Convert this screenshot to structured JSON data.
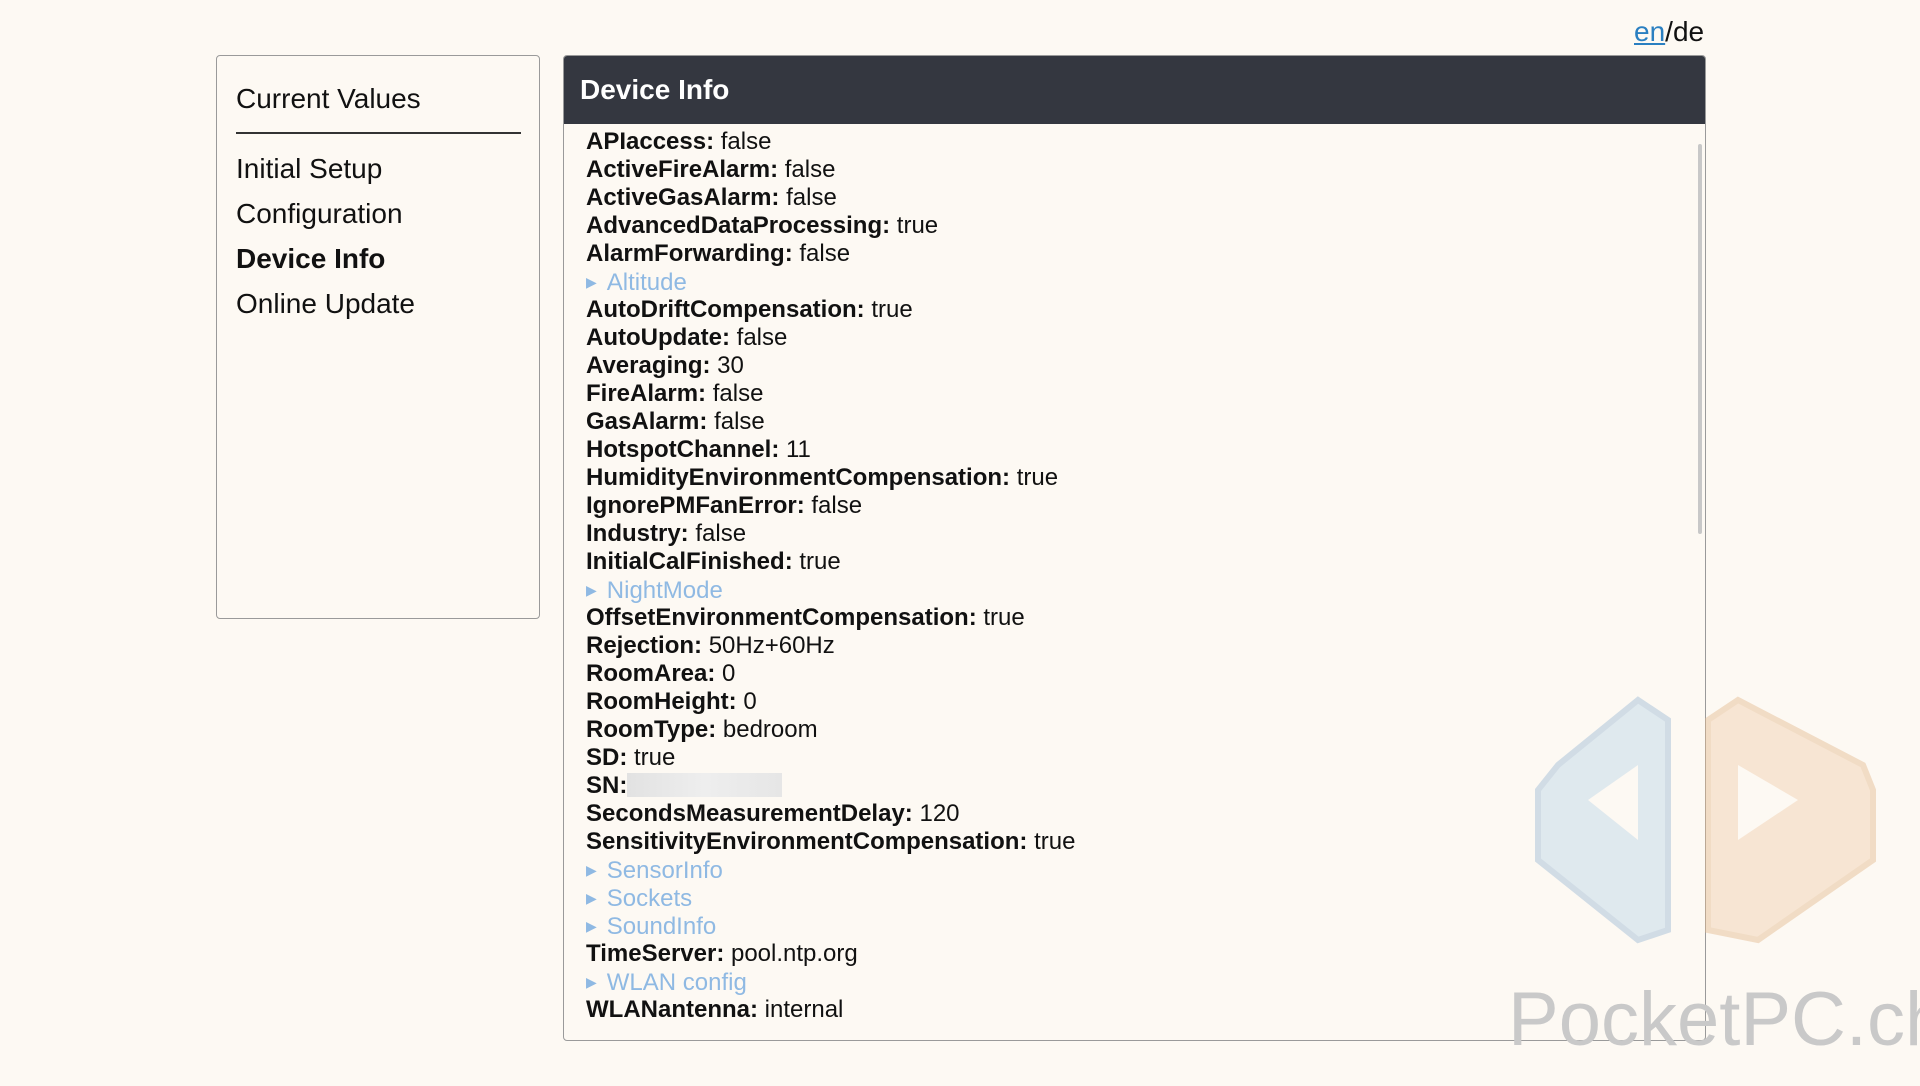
{
  "lang": {
    "en": "en",
    "separator": "/",
    "de": "de"
  },
  "sidebar": {
    "first_item": "Current Values",
    "items": [
      {
        "label": "Initial Setup",
        "active": false
      },
      {
        "label": "Configuration",
        "active": false
      },
      {
        "label": "Device Info",
        "active": true
      },
      {
        "label": "Online Update",
        "active": false
      }
    ]
  },
  "panel": {
    "title": "Device Info",
    "rows": [
      {
        "type": "kv",
        "key": "APIaccess:",
        "value": "false"
      },
      {
        "type": "kv",
        "key": "ActiveFireAlarm:",
        "value": "false"
      },
      {
        "type": "kv",
        "key": "ActiveGasAlarm:",
        "value": "false"
      },
      {
        "type": "kv",
        "key": "AdvancedDataProcessing:",
        "value": "true"
      },
      {
        "type": "kv",
        "key": "AlarmForwarding:",
        "value": "false"
      },
      {
        "type": "expand",
        "label": "Altitude"
      },
      {
        "type": "kv",
        "key": "AutoDriftCompensation:",
        "value": "true"
      },
      {
        "type": "kv",
        "key": "AutoUpdate:",
        "value": "false"
      },
      {
        "type": "kv",
        "key": "Averaging:",
        "value": "30"
      },
      {
        "type": "kv",
        "key": "FireAlarm:",
        "value": "false"
      },
      {
        "type": "kv",
        "key": "GasAlarm:",
        "value": "false"
      },
      {
        "type": "kv",
        "key": "HotspotChannel:",
        "value": "11"
      },
      {
        "type": "kv",
        "key": "HumidityEnvironmentCompensation:",
        "value": "true"
      },
      {
        "type": "kv",
        "key": "IgnorePMFanError:",
        "value": "false"
      },
      {
        "type": "kv",
        "key": "Industry:",
        "value": "false"
      },
      {
        "type": "kv",
        "key": "InitialCalFinished:",
        "value": "true"
      },
      {
        "type": "expand",
        "label": "NightMode"
      },
      {
        "type": "kv",
        "key": "OffsetEnvironmentCompensation:",
        "value": "true"
      },
      {
        "type": "kv",
        "key": "Rejection:",
        "value": "50Hz+60Hz"
      },
      {
        "type": "kv",
        "key": "RoomArea:",
        "value": "0"
      },
      {
        "type": "kv",
        "key": "RoomHeight:",
        "value": "0"
      },
      {
        "type": "kv",
        "key": "RoomType:",
        "value": "bedroom"
      },
      {
        "type": "kv",
        "key": "SD:",
        "value": "true"
      },
      {
        "type": "redacted",
        "key": "SN:"
      },
      {
        "type": "kv",
        "key": "SecondsMeasurementDelay:",
        "value": "120"
      },
      {
        "type": "kv",
        "key": "SensitivityEnvironmentCompensation:",
        "value": "true"
      },
      {
        "type": "expand",
        "label": "SensorInfo"
      },
      {
        "type": "expand",
        "label": "Sockets"
      },
      {
        "type": "expand",
        "label": "SoundInfo"
      },
      {
        "type": "kv",
        "key": "TimeServer:",
        "value": "pool.ntp.org"
      },
      {
        "type": "expand",
        "label": "WLAN config"
      },
      {
        "type": "kv",
        "key": "WLANantenna:",
        "value": "internal"
      }
    ]
  },
  "watermark": {
    "text": "PocketPC.ch"
  },
  "colors": {
    "background": "#fdf9f3",
    "header": "#343740",
    "link": "#2a7fc1",
    "expandable": "#8fb9e3"
  }
}
